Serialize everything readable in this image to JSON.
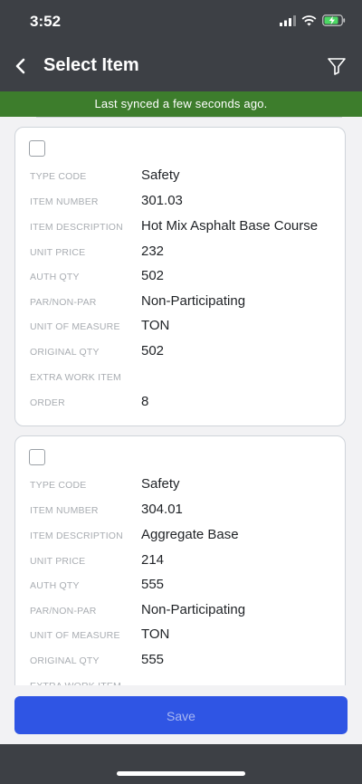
{
  "status": {
    "time": "3:52"
  },
  "nav": {
    "title": "Select Item"
  },
  "sync": {
    "message": "Last synced a few seconds ago."
  },
  "labels": {
    "type_code": "TYPE CODE",
    "item_number": "ITEM NUMBER",
    "item_description": "ITEM DESCRIPTION",
    "unit_price": "UNIT PRICE",
    "auth_qty": "AUTH QTY",
    "par_non_par": "PAR/NON-PAR",
    "unit_of_measure": "UNIT OF MEASURE",
    "original_qty": "ORIGINAL QTY",
    "extra_work_item": "EXTRA WORK ITEM",
    "order": "ORDER"
  },
  "items": [
    {
      "type_code": "Safety",
      "item_number": "301.03",
      "item_description": "Hot Mix Asphalt Base Course",
      "unit_price": "232",
      "auth_qty": "502",
      "par_non_par": "Non-Participating",
      "unit_of_measure": "TON",
      "original_qty": "502",
      "extra_work_item": "",
      "order": "8"
    },
    {
      "type_code": "Safety",
      "item_number": "304.01",
      "item_description": "Aggregate Base",
      "unit_price": "214",
      "auth_qty": "555",
      "par_non_par": "Non-Participating",
      "unit_of_measure": "TON",
      "original_qty": "555",
      "extra_work_item": ""
    }
  ],
  "footer": {
    "save_label": "Save"
  }
}
